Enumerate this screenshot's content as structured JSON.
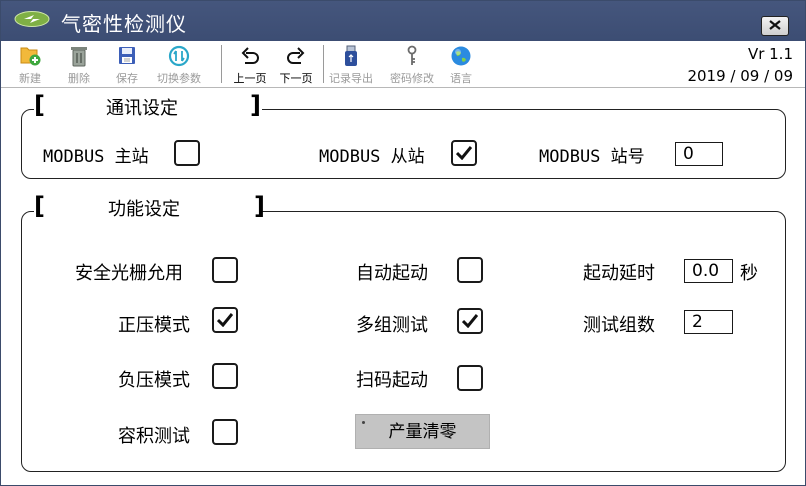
{
  "window": {
    "title": "气密性检测仪"
  },
  "toolbar": {
    "items": [
      {
        "label": "新建",
        "icon": "new-file-icon",
        "enabled": false
      },
      {
        "label": "删除",
        "icon": "trash-icon",
        "enabled": false
      },
      {
        "label": "保存",
        "icon": "save-disk-icon",
        "enabled": false
      },
      {
        "label": "切换参数",
        "icon": "switch-params-icon",
        "enabled": false
      },
      {
        "label": "上一页",
        "icon": "undo-arrow-icon",
        "enabled": true
      },
      {
        "label": "下一页",
        "icon": "redo-arrow-icon",
        "enabled": true
      },
      {
        "label": "记录导出",
        "icon": "usb-drive-icon",
        "enabled": false
      },
      {
        "label": "密码修改",
        "icon": "key-icon",
        "enabled": false
      },
      {
        "label": "语言",
        "icon": "globe-icon",
        "enabled": false
      }
    ],
    "version": "Vr 1.1",
    "date": "2019 / 09 / 09"
  },
  "comm": {
    "title": "通讯设定",
    "master_label": "MODBUS 主站",
    "master_checked": false,
    "slave_label": "MODBUS 从站",
    "slave_checked": true,
    "station_label": "MODBUS 站号",
    "station_value": "0"
  },
  "func": {
    "title": "功能设定",
    "safety_label": "安全光栅允用",
    "safety_checked": false,
    "positive_label": "正压模式",
    "positive_checked": true,
    "negative_label": "负压模式",
    "negative_checked": false,
    "volume_label": "容积测试",
    "volume_checked": false,
    "autostart_label": "自动起动",
    "autostart_checked": false,
    "multigroup_label": "多组测试",
    "multigroup_checked": true,
    "scanstart_label": "扫码起动",
    "scanstart_checked": false,
    "clear_button": "产量清零",
    "delay_label": "起动延时",
    "delay_value": "0.0",
    "delay_unit": "秒",
    "groups_label": "测试组数",
    "groups_value": "2"
  },
  "colors": {
    "titlebar": "#3f5078",
    "button_gray": "#c4c4c4",
    "accent_blue": "#1e6fc0"
  }
}
